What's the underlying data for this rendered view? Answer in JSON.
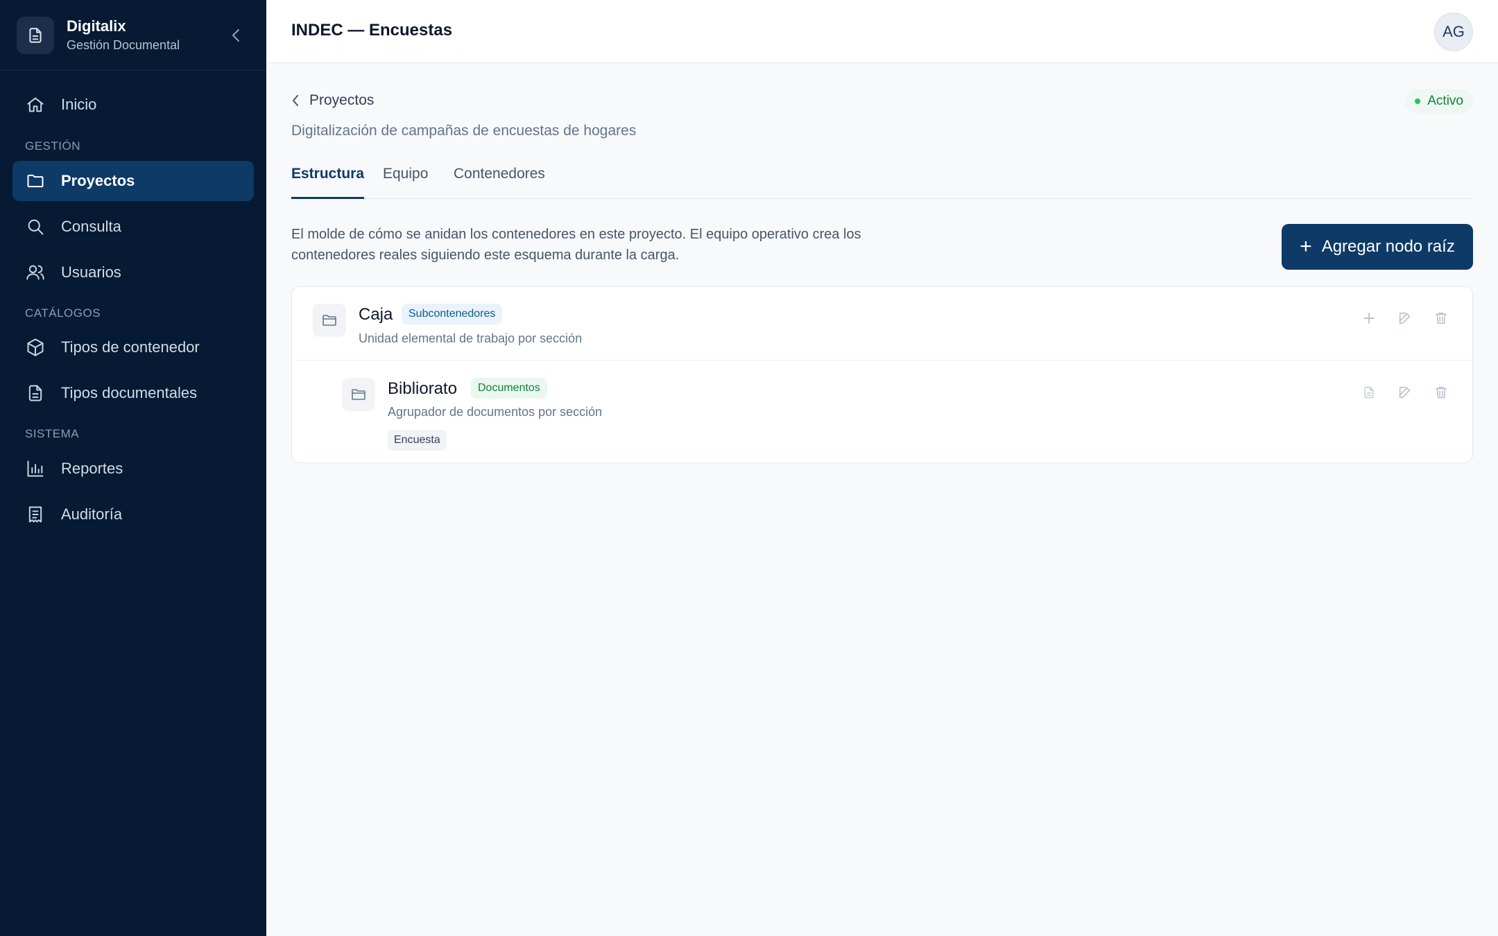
{
  "brand": {
    "name": "Digitalix",
    "subtitle": "Gestión Documental"
  },
  "sidebar": {
    "sections": {
      "gestion": "GESTIÓN",
      "catalogos": "CATÁLOGOS",
      "sistema": "SISTEMA"
    },
    "items": [
      {
        "label": "Inicio",
        "icon": "home-icon"
      },
      {
        "label": "Proyectos",
        "icon": "folder-icon",
        "active": true
      },
      {
        "label": "Consulta",
        "icon": "search-icon"
      },
      {
        "label": "Usuarios",
        "icon": "users-icon"
      },
      {
        "label": "Tipos de contenedor",
        "icon": "box-icon"
      },
      {
        "label": "Tipos documentales",
        "icon": "document-icon"
      },
      {
        "label": "Reportes",
        "icon": "bar-chart-icon"
      },
      {
        "label": "Auditoría",
        "icon": "receipt-icon"
      }
    ]
  },
  "header": {
    "title": "INDEC — Encuestas",
    "avatar_initials": "AG"
  },
  "project": {
    "back_label": "Proyectos",
    "status": "Activo",
    "description": "Digitalización de campañas de encuestas de hogares"
  },
  "tabs": [
    {
      "label": "Estructura",
      "active": true
    },
    {
      "label": "Equipo"
    },
    {
      "label": "Contenedores"
    }
  ],
  "structure": {
    "intro": "El molde de cómo se anidan los contenedores en este proyecto. El equipo operativo crea los contenedores reales siguiendo este esquema durante la carga.",
    "add_root_label": "Agregar nodo raíz",
    "nodes": [
      {
        "name": "Caja",
        "badge": "Subcontenedores",
        "description": "Unidad elemental de trabajo por sección"
      },
      {
        "name": "Bibliorato",
        "badge": "Documentos",
        "description": "Agrupador de documentos por sección",
        "doc_types": [
          "Encuesta"
        ]
      }
    ]
  },
  "colors": {
    "sidebar_bg": "#061a33",
    "accent": "#0d3a66",
    "status_green": "#15803d"
  }
}
